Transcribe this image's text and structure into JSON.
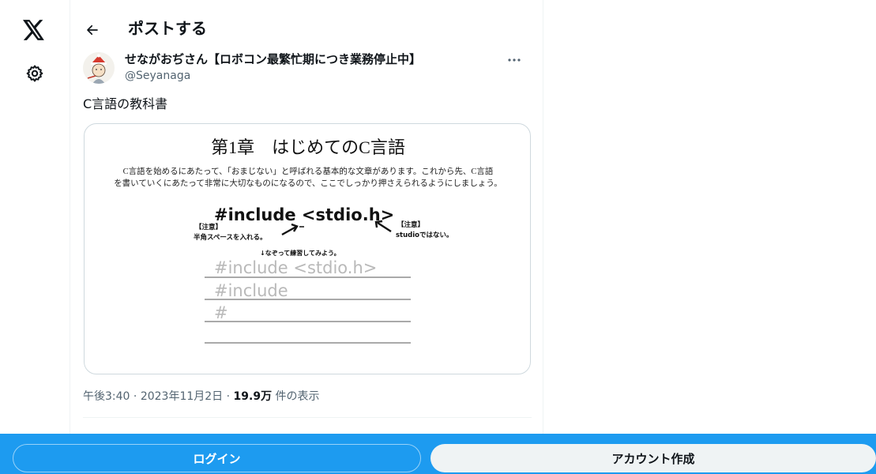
{
  "nav": {
    "logo_icon": "x-logo-icon",
    "settings_icon": "gear-icon"
  },
  "header": {
    "back_icon": "arrow-left-icon",
    "title": "ポストする"
  },
  "post": {
    "author_name": "せながおぢさん【ロボコン最繁忙期につき業務停止中】",
    "author_handle": "@Seyanaga",
    "more_icon": "more-horizontal-icon",
    "text": "C言語の教科書",
    "meta": {
      "time": "午後3:40",
      "date": "2023年11月2日",
      "views": "19.9万",
      "views_suffix": " 件の表示"
    }
  },
  "media": {
    "heading": "第1章　はじめてのC言語",
    "intro_line1": "C言語を始めるにあたって、「おまじない」と呼ばれる基本的な文章があります。これから先、C言語",
    "intro_line2": "を書いていくにあたって非常に大切なものになるので、ここでしっかり押さえられるようにしましょう。",
    "code_main": "#include <stdio.h>",
    "note1_title": "【注意】",
    "note1_text": "半角スペースを入れる。",
    "note2_title": "【注意】",
    "note2_text": "studioではない。",
    "trace_hint": "↓なぞって練習してみよう。",
    "trace_lines": [
      "#include <stdio.h>",
      "#include",
      "#"
    ]
  },
  "footer": {
    "login_label": "ログイン",
    "signup_label": "アカウント作成"
  },
  "colors": {
    "accent": "#1d9bf0",
    "text": "#0f1419",
    "secondary": "#536471",
    "border": "#cfd9de"
  }
}
